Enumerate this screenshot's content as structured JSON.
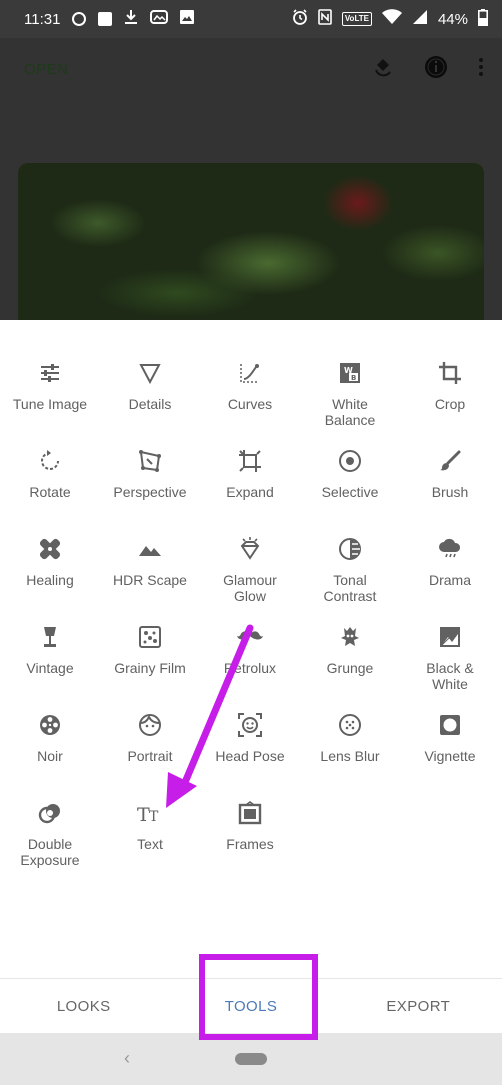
{
  "status_bar": {
    "time": "11:31",
    "battery": "44%",
    "volte": "VoLTE"
  },
  "app_bar": {
    "open_label": "OPEN"
  },
  "tools": [
    {
      "label": "Tune Image",
      "icon": "tune-icon"
    },
    {
      "label": "Details",
      "icon": "details-icon"
    },
    {
      "label": "Curves",
      "icon": "curves-icon"
    },
    {
      "label": "White\nBalance",
      "icon": "white-balance-icon"
    },
    {
      "label": "Crop",
      "icon": "crop-icon"
    },
    {
      "label": "Rotate",
      "icon": "rotate-icon"
    },
    {
      "label": "Perspective",
      "icon": "perspective-icon"
    },
    {
      "label": "Expand",
      "icon": "expand-icon"
    },
    {
      "label": "Selective",
      "icon": "selective-icon"
    },
    {
      "label": "Brush",
      "icon": "brush-icon"
    },
    {
      "label": "Healing",
      "icon": "healing-icon"
    },
    {
      "label": "HDR Scape",
      "icon": "hdr-scape-icon"
    },
    {
      "label": "Glamour\nGlow",
      "icon": "glamour-glow-icon"
    },
    {
      "label": "Tonal\nContrast",
      "icon": "tonal-contrast-icon"
    },
    {
      "label": "Drama",
      "icon": "drama-icon"
    },
    {
      "label": "Vintage",
      "icon": "vintage-icon"
    },
    {
      "label": "Grainy Film",
      "icon": "grainy-film-icon"
    },
    {
      "label": "Retrolux",
      "icon": "retrolux-icon"
    },
    {
      "label": "Grunge",
      "icon": "grunge-icon"
    },
    {
      "label": "Black &\nWhite",
      "icon": "black-white-icon"
    },
    {
      "label": "Noir",
      "icon": "noir-icon"
    },
    {
      "label": "Portrait",
      "icon": "portrait-icon"
    },
    {
      "label": "Head Pose",
      "icon": "head-pose-icon"
    },
    {
      "label": "Lens Blur",
      "icon": "lens-blur-icon"
    },
    {
      "label": "Vignette",
      "icon": "vignette-icon"
    },
    {
      "label": "Double\nExposure",
      "icon": "double-exposure-icon"
    },
    {
      "label": "Text",
      "icon": "text-icon"
    },
    {
      "label": "Frames",
      "icon": "frames-icon"
    }
  ],
  "tabs": {
    "looks": "LOOKS",
    "tools": "TOOLS",
    "export": "EXPORT"
  },
  "nav": {
    "back": "‹"
  },
  "colors": {
    "annotation": "#c61ee8",
    "active_tab": "#4a7ab8",
    "icon": "#616161"
  }
}
